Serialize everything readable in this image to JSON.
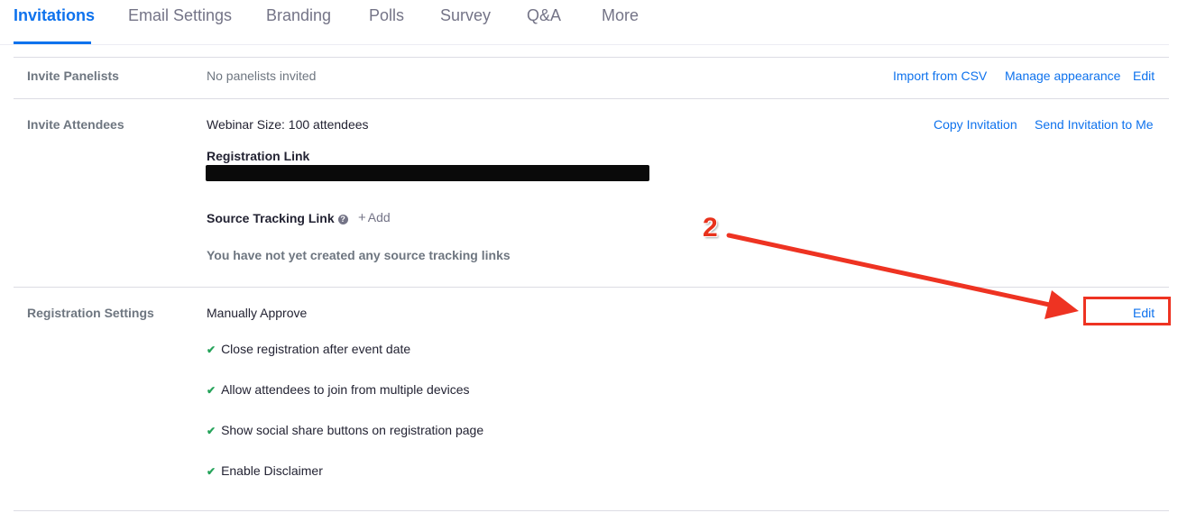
{
  "tabs": [
    {
      "label": "Invitations"
    },
    {
      "label": "Email Settings"
    },
    {
      "label": "Branding"
    },
    {
      "label": "Polls"
    },
    {
      "label": "Survey"
    },
    {
      "label": "Q&A"
    },
    {
      "label": "More"
    }
  ],
  "panelists": {
    "label": "Invite Panelists",
    "value": "No panelists invited",
    "import_link": "Import from CSV",
    "manage_link": "Manage appearance",
    "edit_link": "Edit"
  },
  "attendees": {
    "label": "Invite Attendees",
    "webinar_size": "Webinar Size: 100 attendees",
    "copy_link": "Copy Invitation",
    "send_link": "Send Invitation to Me",
    "registration_link_heading": "Registration Link",
    "source_tracking_heading": "Source Tracking Link",
    "add_label": "Add",
    "no_tracking_text": "You have not yet created any source tracking links"
  },
  "registration": {
    "label": "Registration Settings",
    "approval": "Manually Approve",
    "edit_link": "Edit",
    "options": [
      "Close registration after event date",
      "Allow attendees to join from multiple devices",
      "Show social share buttons on registration page",
      "Enable Disclaimer"
    ]
  },
  "annotation": {
    "step_number": "2",
    "color": "#ee3322"
  },
  "colors": {
    "accent": "#0e72ed",
    "check": "#25a35a"
  }
}
